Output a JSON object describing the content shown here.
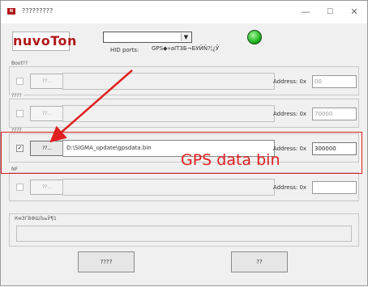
{
  "window": {
    "title": "?????????",
    "icon_text": "N",
    "controls": {
      "minimize": "—",
      "maximize": "☐",
      "close": "✕"
    }
  },
  "header": {
    "logo_text": "nuvoTon",
    "hid_ports_label": "HID ports:",
    "hid_select_value": "",
    "gps_status_text": "GPS◆»аIТЗБ¬БУЙÑ?¦¿Ў",
    "led_color": "#1fb51f"
  },
  "groups": [
    {
      "label": "Boot??",
      "checked": false,
      "button_label": "??...",
      "path": "",
      "address_label": "Address: 0x",
      "address_value": "00"
    },
    {
      "label": "????",
      "checked": false,
      "button_label": "??...",
      "path": "",
      "address_label": "Address: 0x",
      "address_value": "70000"
    },
    {
      "label": "????",
      "checked": true,
      "button_label": "??...",
      "path": "D:\\SIGMA_update\\gpsdata.bin",
      "address_label": "Address: 0x",
      "address_value": "300000"
    },
    {
      "label": "NF",
      "checked": false,
      "button_label": "??...",
      "path": "",
      "address_label": "Address: 0x",
      "address_value": ""
    }
  ],
  "status": {
    "label": "КмЗГВФШЪьЎ¶1",
    "text": ""
  },
  "buttons": {
    "left_label": "????",
    "right_label": "??"
  },
  "annotation": {
    "text": "GPS data bin",
    "color": "#e02020"
  }
}
